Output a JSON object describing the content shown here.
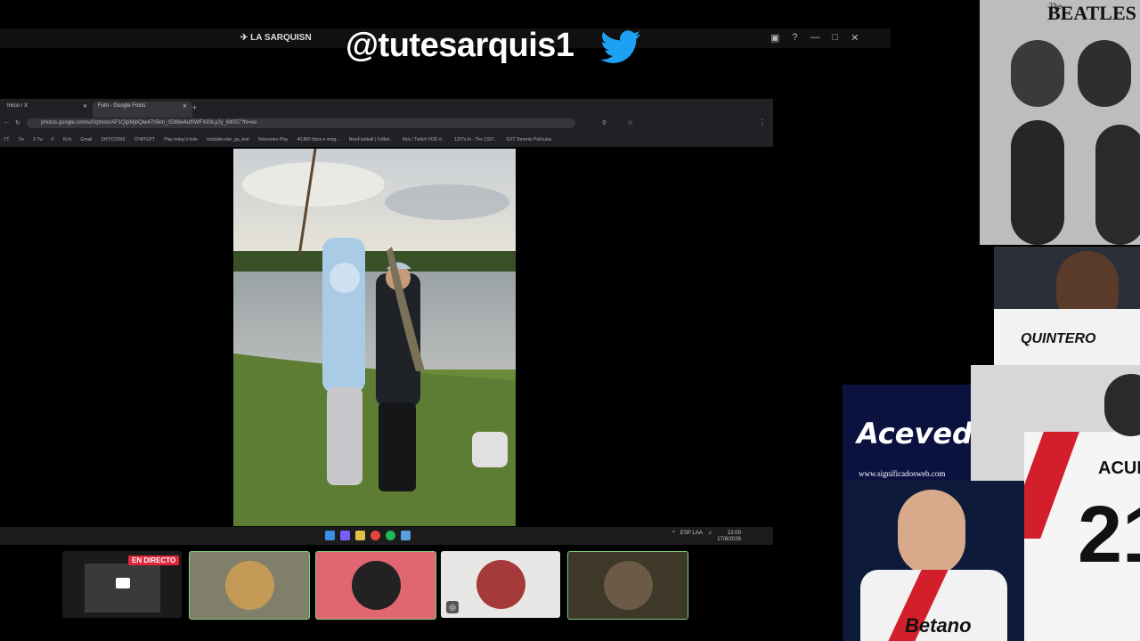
{
  "overlay": {
    "channel_name": "LA SARQUISN",
    "handle": "@tutesarquis1",
    "twitter_icon": "twitter-bird-icon"
  },
  "browser": {
    "tabs": [
      "Inicio / X",
      "Foto - Google Fotos"
    ],
    "url": "photos.google.com/u/0/photo/AF1QipMjbQlw47r5kln_r53t6w4uf0WFX83Ly2y_6ll0S7?hl=es",
    "bookmarks": [
      "YT",
      "Tw",
      "X Tw",
      "F",
      "Kick",
      "Gmail",
      "SHITCOINS",
      "CHATGPT",
      "Play today's hole",
      "ciudadecolor_ga_test",
      "Telecentro Play",
      "40.850 fotos e imág...",
      "NowFootball | Fútbol...",
      "Kick / Twitch VOD d...",
      "1337x.to - The 1337...",
      "EXT Torrents Películas"
    ]
  },
  "taskbar": {
    "lang": "ESP\nLAA",
    "time": "22:00",
    "date": "17/8/2026"
  },
  "call": {
    "live_badge": "EN DIRECTO"
  },
  "side": {
    "beatles_logo": "BEATLES",
    "beatles_prefix": "The",
    "quintero_name": "QUINTERO",
    "acevedo_title": "Acevedo",
    "acevedo_site": "www.significadosweb.com",
    "acuna_name": "ACUÑA",
    "acuna_number": "21",
    "sponsor": "Betano"
  }
}
